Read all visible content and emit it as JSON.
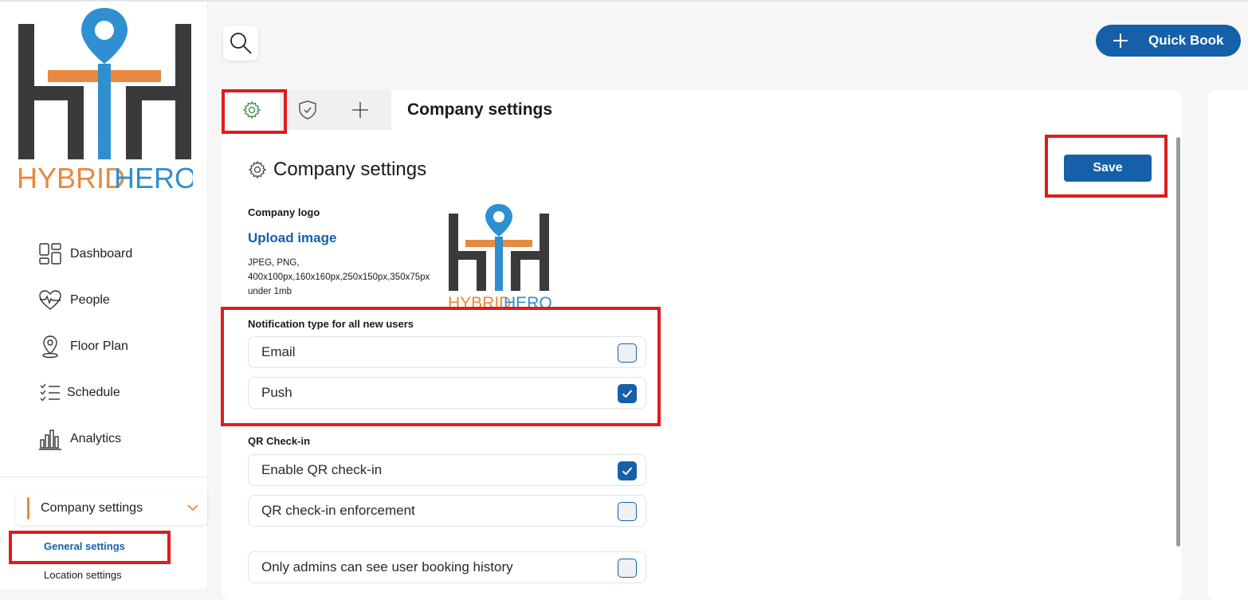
{
  "brand": {
    "logo_text_part1": "HYBRID",
    "logo_text_part2": "HERO",
    "orange": "#e8893f",
    "blue": "#2f8fd0",
    "dark": "#3a3a3a"
  },
  "colors": {
    "accent": "#1560a8",
    "highlight": "#e01b1b"
  },
  "sidebar": {
    "nav": [
      {
        "label": "Dashboard",
        "icon": "dashboard-icon"
      },
      {
        "label": "People",
        "icon": "heart-pulse-icon"
      },
      {
        "label": "Floor Plan",
        "icon": "map-pin-icon"
      },
      {
        "label": "Schedule",
        "icon": "checklist-icon"
      },
      {
        "label": "Analytics",
        "icon": "bar-chart-icon"
      }
    ],
    "group": {
      "label": "Company settings",
      "sub_items": [
        "General settings",
        "Location settings"
      ]
    }
  },
  "topbar": {
    "quick_book_label": "Quick Book"
  },
  "tabs": [
    "settings-gear-icon",
    "shield-check-icon",
    "plus-icon"
  ],
  "panel": {
    "heading": "Company settings",
    "section_title": "Company settings",
    "save_label": "Save",
    "logo": {
      "label": "Company logo",
      "upload_label": "Upload image",
      "formats_line1": "JPEG, PNG,",
      "formats_line2": "400x100px,160x160px,250x150px,350x75px",
      "formats_line3": "under 1mb"
    },
    "notification": {
      "label": "Notification type for all new users",
      "options": [
        {
          "label": "Email",
          "checked": false
        },
        {
          "label": "Push",
          "checked": true
        }
      ]
    },
    "qr": {
      "label": "QR Check-in",
      "options": [
        {
          "label": "Enable QR check-in",
          "checked": true
        },
        {
          "label": "QR check-in enforcement",
          "checked": false
        }
      ]
    },
    "history": {
      "label": "Only admins can see user booking history",
      "checked": false
    }
  }
}
